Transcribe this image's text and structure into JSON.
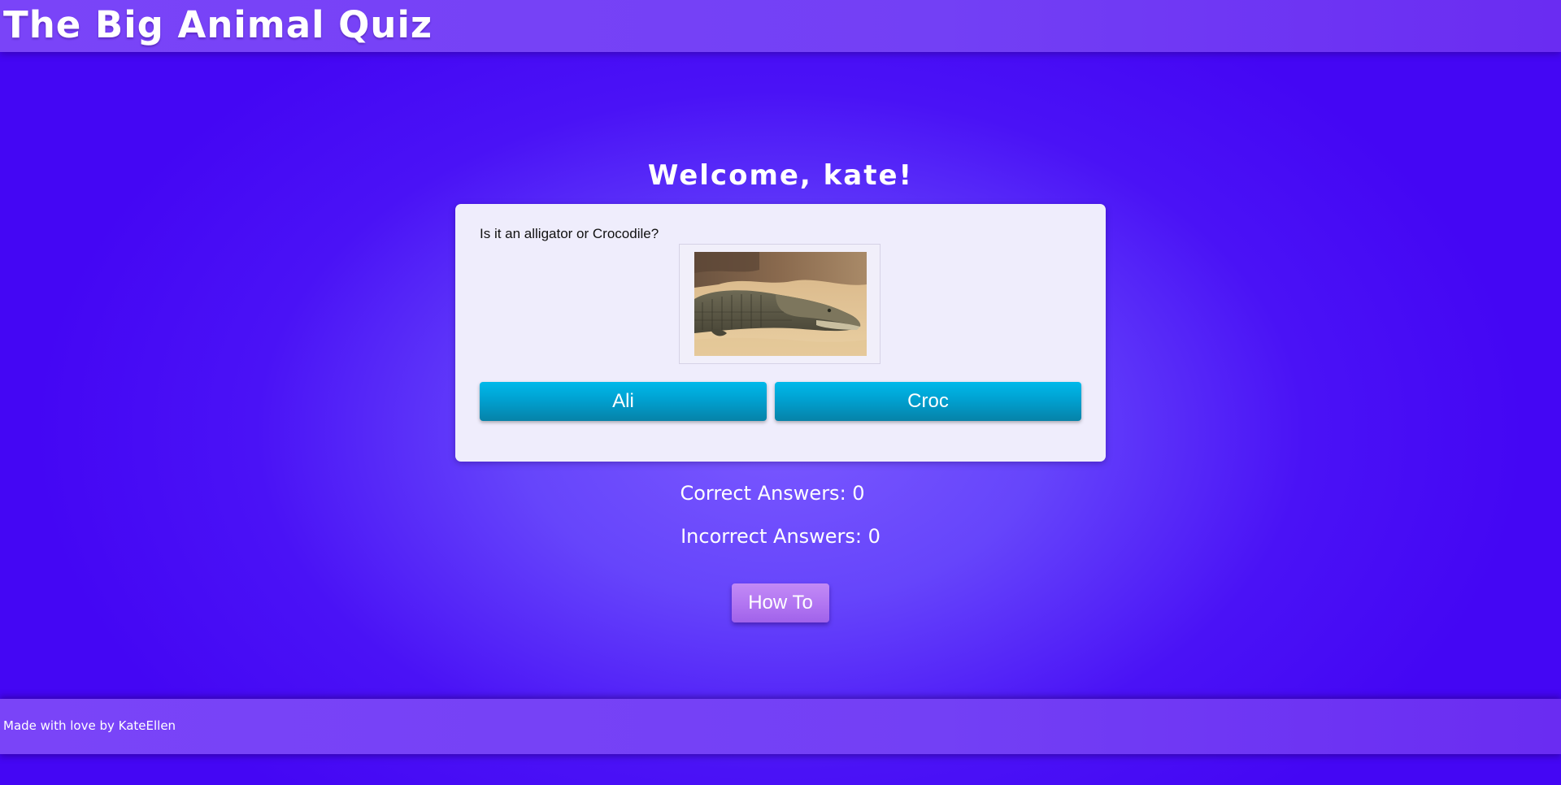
{
  "header": {
    "title": "The Big Animal Quiz"
  },
  "welcome": {
    "text": "Welcome, kate!"
  },
  "quiz": {
    "question": "Is it an alligator or Crocodile?",
    "image_alt": "crocodile-photo",
    "answers": [
      {
        "label": "Ali"
      },
      {
        "label": "Croc"
      }
    ]
  },
  "score": {
    "correct_text": "Correct Answers: 0",
    "incorrect_text": "Incorrect Answers: 0"
  },
  "howto": {
    "label": "How To"
  },
  "footer": {
    "text": "Made with love by KateEllen"
  },
  "colors": {
    "background": "#4a12f6",
    "header_bar": "#7340f5",
    "card": "#efedfc",
    "answer_button": "#00a1d1",
    "howto_button": "#b377f2"
  }
}
